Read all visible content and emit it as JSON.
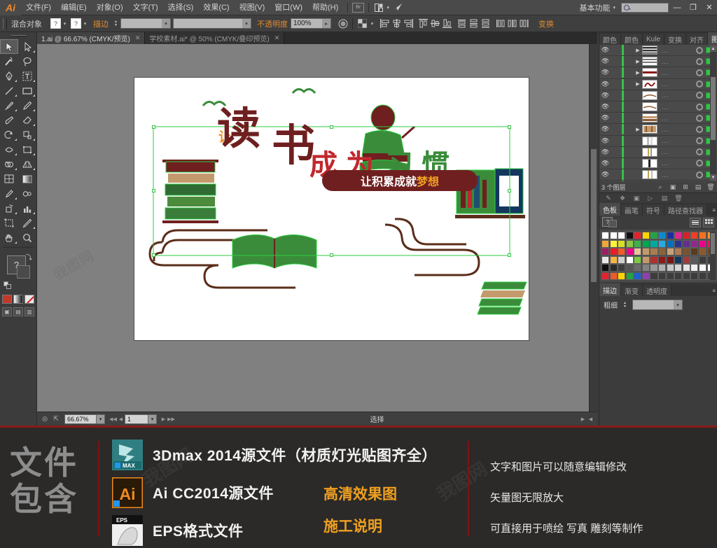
{
  "app": {
    "name": "Adobe Illustrator",
    "logo": "Ai"
  },
  "menubar": {
    "items": [
      {
        "label": "文件(F)"
      },
      {
        "label": "编辑(E)"
      },
      {
        "label": "对象(O)"
      },
      {
        "label": "文字(T)"
      },
      {
        "label": "选择(S)"
      },
      {
        "label": "效果(C)"
      },
      {
        "label": "视图(V)"
      },
      {
        "label": "窗口(W)"
      },
      {
        "label": "帮助(H)"
      }
    ],
    "bridge_label": "Br",
    "arrange_icon": "arrange-documents-icon",
    "stock_icon": "adobe-stock-icon",
    "workspace": "基本功能",
    "workspace_caret": "▾",
    "search_placeholder": "",
    "window_minimize": "—",
    "window_maximize": "❐",
    "window_close": "✕"
  },
  "controlbar": {
    "object_label": "混合对象",
    "fill_swatch": "?",
    "stroke_swatch": "?",
    "caret": "▾",
    "stroke_label": "描边",
    "stroke_weight": "",
    "stroke_profile": "",
    "opacity_label": "不透明度",
    "opacity_value": "100%",
    "style_icon": "graphic-style-icon",
    "transparency_icon": "transparency-grid-icon",
    "align_icons": [
      "align-left-icon",
      "align-center-h-icon",
      "align-right-icon",
      "align-top-icon",
      "align-middle-v-icon",
      "align-bottom-icon",
      "distribute-top-icon",
      "distribute-center-icon",
      "distribute-bottom-icon",
      "distribute-left-icon",
      "distribute-center-h-icon",
      "distribute-right-icon"
    ],
    "transform_label": "变换"
  },
  "tabs": [
    {
      "label": "1.ai @ 66.67% (CMYK/预览)",
      "active": true,
      "close": "✕"
    },
    {
      "label": "学校素材.ai* @ 50% (CMYK/叠印预览)",
      "active": false,
      "close": "✕"
    }
  ],
  "toolbar": {
    "tools": [
      {
        "name": "selection-tool",
        "glyph": "arrow-solid",
        "selected": true,
        "more": false
      },
      {
        "name": "direct-selection-tool",
        "glyph": "arrow-hollow",
        "selected": false,
        "more": true
      },
      {
        "name": "magic-wand-tool",
        "glyph": "wand",
        "selected": false,
        "more": false
      },
      {
        "name": "lasso-tool",
        "glyph": "lasso",
        "selected": false,
        "more": false
      },
      {
        "name": "pen-tool",
        "glyph": "pen",
        "selected": false,
        "more": true
      },
      {
        "name": "type-tool",
        "glyph": "type",
        "selected": false,
        "more": true
      },
      {
        "name": "line-segment-tool",
        "glyph": "line",
        "selected": false,
        "more": true
      },
      {
        "name": "rectangle-tool",
        "glyph": "rect",
        "selected": false,
        "more": true
      },
      {
        "name": "paintbrush-tool",
        "glyph": "brush",
        "selected": false,
        "more": true
      },
      {
        "name": "pencil-tool",
        "glyph": "pencil",
        "selected": false,
        "more": true
      },
      {
        "name": "blob-brush-tool",
        "glyph": "blob",
        "selected": false,
        "more": false
      },
      {
        "name": "eraser-tool",
        "glyph": "eraser",
        "selected": false,
        "more": true
      },
      {
        "name": "rotate-tool",
        "glyph": "rotate",
        "selected": false,
        "more": true
      },
      {
        "name": "scale-tool",
        "glyph": "scale",
        "selected": false,
        "more": true
      },
      {
        "name": "width-tool",
        "glyph": "width",
        "selected": false,
        "more": true
      },
      {
        "name": "free-transform-tool",
        "glyph": "freetransform",
        "selected": false,
        "more": true
      },
      {
        "name": "shape-builder-tool",
        "glyph": "shapebuilder",
        "selected": false,
        "more": true
      },
      {
        "name": "perspective-grid-tool",
        "glyph": "perspective",
        "selected": false,
        "more": true
      },
      {
        "name": "mesh-tool",
        "glyph": "mesh",
        "selected": false,
        "more": false
      },
      {
        "name": "gradient-tool",
        "glyph": "gradient",
        "selected": false,
        "more": false
      },
      {
        "name": "eyedropper-tool",
        "glyph": "eyedropper",
        "selected": false,
        "more": true
      },
      {
        "name": "blend-tool",
        "glyph": "blend",
        "selected": false,
        "more": false
      },
      {
        "name": "symbol-sprayer-tool",
        "glyph": "symbolspray",
        "selected": false,
        "more": true
      },
      {
        "name": "column-graph-tool",
        "glyph": "graph",
        "selected": false,
        "more": true
      },
      {
        "name": "artboard-tool",
        "glyph": "artboard",
        "selected": false,
        "more": false
      },
      {
        "name": "slice-tool",
        "glyph": "slice",
        "selected": false,
        "more": true
      },
      {
        "name": "hand-tool",
        "glyph": "hand",
        "selected": false,
        "more": true
      },
      {
        "name": "zoom-tool",
        "glyph": "zoom",
        "selected": false,
        "more": false
      }
    ],
    "fill_label": "?",
    "swap_icon": "swap-fill-stroke-icon",
    "default_icon": "default-fill-stroke-icon",
    "color_modes": [
      "color-mode-icon",
      "gradient-mode-icon",
      "none-mode-icon"
    ],
    "screen_modes": [
      "normal-screen-icon",
      "full-screen-menubar-icon",
      "full-screen-icon"
    ]
  },
  "canvas": {
    "artwork": {
      "headline_small": "让",
      "headline_big_1": "读",
      "headline_big_2": "书",
      "tail_1": "成",
      "tail_2": "为",
      "tail_3": "习",
      "tail_4": "惯",
      "banner_text_white": "让积累成就",
      "banner_text_orange": "梦想",
      "colors": {
        "dark_red": "#6f1f1f",
        "bright_red": "#c1272d",
        "orange": "#f08a1e",
        "green_path": "#35c24a",
        "brown": "#5a2d1a"
      }
    },
    "watermark": "我图网"
  },
  "statusbar": {
    "doc_icon": "document-info-icon",
    "export_icon": "share-icon",
    "zoom_level": "66.67%",
    "zoom_caret": "▾",
    "page_first": "◀◀",
    "page_prev": "◀",
    "page_number": "1",
    "page_caret": "▾",
    "page_next": "▶",
    "page_last": "▶▶",
    "status_text": "选择",
    "arrow_right": "▶",
    "arrow_left": "◀"
  },
  "dock": {
    "top_tabs": [
      {
        "label": "颜色",
        "active": false
      },
      {
        "label": "颜色",
        "active": false
      },
      {
        "label": "Kule",
        "active": false
      },
      {
        "label": "变换",
        "active": false
      },
      {
        "label": "对齐",
        "active": false
      },
      {
        "label": "图层",
        "active": true
      }
    ],
    "panel_menu": "≡",
    "layers": [
      {
        "thumb": "stripes-dark",
        "expandable": true,
        "dots": "..."
      },
      {
        "thumb": "stripes-gray",
        "expandable": true,
        "dots": "..."
      },
      {
        "thumb": "stripes-red",
        "expandable": true,
        "dots": "..."
      },
      {
        "thumb": "script-red",
        "expandable": true,
        "dots": "..."
      },
      {
        "thumb": "curve-brown",
        "expandable": false,
        "dots": "..."
      },
      {
        "thumb": "curve-brown2",
        "expandable": false,
        "dots": "..."
      },
      {
        "thumb": "books-stack",
        "expandable": false,
        "dots": "..."
      },
      {
        "thumb": "books-shelf",
        "expandable": true,
        "dots": "..."
      },
      {
        "thumb": "page-white",
        "expandable": false,
        "dots": "..."
      },
      {
        "thumb": "page-white2",
        "expandable": false,
        "dots": "..."
      },
      {
        "thumb": "page-dark",
        "expandable": false,
        "dots": "..."
      },
      {
        "thumb": "page-light",
        "expandable": false,
        "dots": "..."
      },
      {
        "thumb": "page-red",
        "expandable": false,
        "dots": "..."
      }
    ],
    "layers_footer_count": "3 个图层",
    "layers_footer_icons": [
      "locate-object-icon",
      "make-clipping-mask-icon",
      "create-sublayer-icon",
      "new-layer-icon",
      "delete-layer-icon"
    ],
    "mid_strip_icons": [
      "brushes-icon",
      "symbols-icon",
      "links-icon",
      "actions-icon",
      "new-icon",
      "trash-icon"
    ],
    "swatches_tabs": [
      {
        "label": "色板",
        "active": true
      },
      {
        "label": "画笔",
        "active": false
      },
      {
        "label": "符号",
        "active": false
      },
      {
        "label": "路径查找器",
        "active": false
      }
    ],
    "swatches_rows": [
      [
        "#ffffff",
        "#ffffff",
        "#ffffff",
        "#111111",
        "#e8202a",
        "#ffd400",
        "#25a244",
        "#0a8bd4",
        "#1b2ea0",
        "#e5238f",
        "#d62229",
        "#ef3e23",
        "#f37021",
        "#f7941e"
      ],
      [
        "#f0a73a",
        "#fff23f",
        "#d7df23",
        "#8dc63f",
        "#39b54a",
        "#00a651",
        "#00a99d",
        "#27aae1",
        "#0072bc",
        "#2e3192",
        "#662d91",
        "#92278f",
        "#ec008c",
        "#ed145b"
      ],
      [
        "#9e1f63",
        "#ed1c24",
        "#f15a29",
        "#ec008c",
        "#e8c39e",
        "#c49a6c",
        "#a97c50",
        "#8c6239",
        "#c7a17a",
        "#b07b4f",
        "#7a5230",
        "#5c3b1e",
        "#8b5a2b",
        "#6b4423"
      ],
      [
        "#e8e8e8",
        "#f6b545",
        "#cfcfcf",
        "#ffffff",
        "#7ac943",
        "#c49a6c",
        "#b03030",
        "#8b1a1a",
        "#7a1515",
        "#14375e",
        "#a33a3a",
        "#5a5a5a",
        "#3c3c3c",
        "#3c3c3c"
      ],
      [
        "#0d0d0d",
        "#2a2a2a",
        "#3d3d3d",
        "#545454",
        "#6b6b6b",
        "#828282",
        "#999999",
        "#b0b0b0",
        "#c7c7c7",
        "#d6d6d6",
        "#e5e5e5",
        "#f0f0f0",
        "#fafafa",
        "#ffffff"
      ],
      [
        "#e8202a",
        "#f15a29",
        "#ffd400",
        "#25a244",
        "#1b5fd4",
        "#8e3fb0",
        "#3c3c3c",
        "#3c3c3c",
        "#3c3c3c",
        "#3c3c3c",
        "#3c3c3c",
        "#3c3c3c",
        "#3c3c3c",
        "#3c3c3c"
      ]
    ],
    "bottom_tabs": [
      {
        "label": "描边",
        "active": true
      },
      {
        "label": "渐变",
        "active": false
      },
      {
        "label": "透明度",
        "active": false
      }
    ],
    "stroke_weight_label": "粗细",
    "stroke_weight_value": ""
  },
  "banner": {
    "left_title_line1": "文件",
    "left_title_line2": "包含",
    "items": [
      {
        "icon": "3dsmax-icon",
        "icon_label": "MAX",
        "text": "3Dmax 2014源文件（材质灯光贴图齐全）"
      },
      {
        "icon": "illustrator-icon",
        "icon_label": "Ai",
        "text": "Ai CC2014源文件"
      },
      {
        "icon": "eps-icon",
        "icon_label": "EPS",
        "text": "EPS格式文件"
      }
    ],
    "highlights": [
      "高清效果图",
      "施工说明"
    ],
    "features": [
      "文字和图片可以随意编辑修改",
      "矢量图无限放大",
      "可直接用于喷绘 写真 雕刻等制作"
    ],
    "accent_orange": "#f0a020",
    "divider_red": "#7e1414"
  }
}
